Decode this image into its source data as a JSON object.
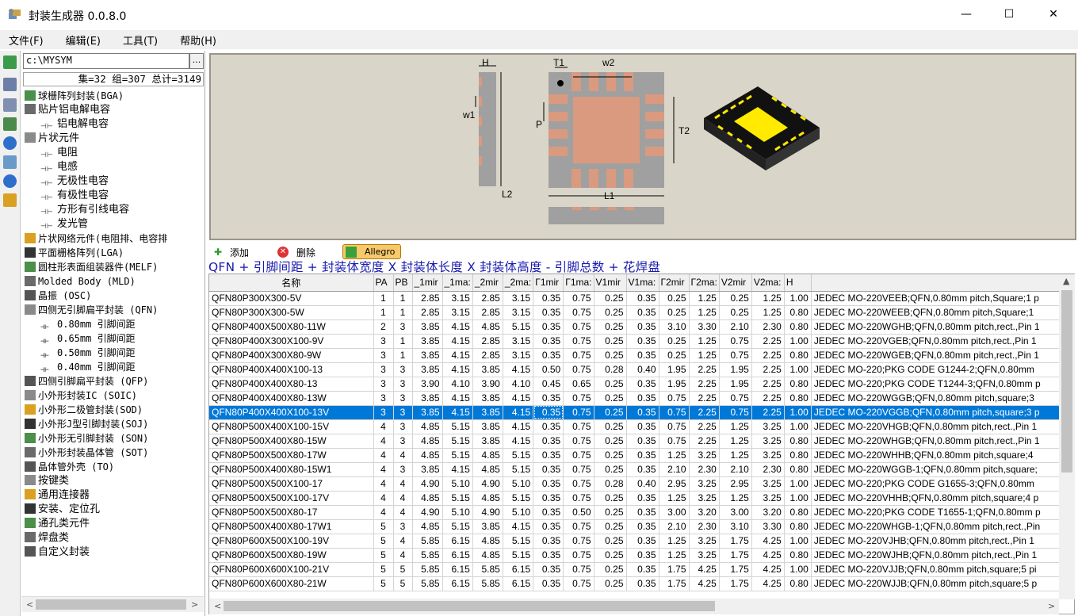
{
  "window": {
    "title": "封装生成器 0.0.8.0",
    "minimize": "—",
    "maximize": "☐",
    "close": "✕"
  },
  "menu": [
    {
      "label": "文件(F)"
    },
    {
      "label": "编辑(E)"
    },
    {
      "label": "工具(T)"
    },
    {
      "label": "帮助(H)"
    }
  ],
  "left_toolbar": [
    "import-icon",
    "library-icon",
    "list-icon",
    "tools-icon",
    "info-icon",
    "refresh-icon",
    "help-icon",
    "exit-icon"
  ],
  "path": {
    "value": "c:\\MYSYM",
    "browse": "..."
  },
  "stats": "集=32 组=307 总计=3149",
  "tree": [
    {
      "label": "球栅阵列封装(BGA)",
      "mono": true
    },
    {
      "label": "贴片铝电解电容"
    },
    {
      "label": "铝电解电容",
      "child": true
    },
    {
      "label": "片状元件"
    },
    {
      "label": "电阻",
      "child": true
    },
    {
      "label": "电感",
      "child": true
    },
    {
      "label": "无极性电容",
      "child": true
    },
    {
      "label": "有极性电容",
      "child": true
    },
    {
      "label": "方形有引线电容",
      "child": true
    },
    {
      "label": "发光管",
      "child": true
    },
    {
      "label": "片状网络元件(电阻排、电容排",
      "mono": true
    },
    {
      "label": "平面栅格阵列(LGA)",
      "mono": true
    },
    {
      "label": "圆柱形表面组装器件(MELF)",
      "mono": true
    },
    {
      "label": "Molded Body (MLD)",
      "mono": true
    },
    {
      "label": "晶振 (OSC)",
      "mono": true
    },
    {
      "label": "四侧无引脚扁平封装 (QFN)",
      "mono": true
    },
    {
      "label": "0.80mm 引脚间距",
      "child": true,
      "mono": true
    },
    {
      "label": "0.65mm 引脚间距",
      "child": true,
      "mono": true
    },
    {
      "label": "0.50mm 引脚间距",
      "child": true,
      "mono": true
    },
    {
      "label": "0.40mm 引脚间距",
      "child": true,
      "mono": true
    },
    {
      "label": "四侧引脚扁平封装 (QFP)",
      "mono": true
    },
    {
      "label": "小外形封装IC (SOIC)",
      "mono": true
    },
    {
      "label": "小外形二极管封装(SOD)",
      "mono": true
    },
    {
      "label": "小外形J型引脚封装(SOJ)",
      "mono": true
    },
    {
      "label": "小外形无引脚封装 (SON)",
      "mono": true
    },
    {
      "label": "小外形封装晶体管 (SOT)",
      "mono": true
    },
    {
      "label": "晶体管外壳 (TO)",
      "mono": true
    },
    {
      "label": "按键类"
    },
    {
      "label": "通用连接器"
    },
    {
      "label": "安装、定位孔"
    },
    {
      "label": "通孔类元件"
    },
    {
      "label": "焊盘类"
    },
    {
      "label": "自定义封装"
    }
  ],
  "preview_labels": {
    "H": "H",
    "w1": "w1",
    "L2": "L2",
    "T1": "T1",
    "w2": "w2",
    "P": "P",
    "T2": "T2",
    "L1": "L1"
  },
  "actions": {
    "add": "添加",
    "delete": "删除",
    "allegro": "Allegro"
  },
  "formula": "QFN + 引脚间距 + 封装体宽度 X 封装体长度 X 封装体高度 - 引脚总数 + 花焊盘",
  "columns": [
    "名称",
    "PA",
    "PB",
    "_1mir",
    "_1ma:",
    "_2mir",
    "_2ma:",
    "Γ1mir",
    "Γ1ma:",
    "V1mir",
    "V1ma:",
    "Γ2mir",
    "Γ2ma:",
    "V2mir",
    "V2ma:",
    "H",
    ""
  ],
  "rows": [
    [
      "QFN80P300X300-5V",
      "1",
      "1",
      "2.85",
      "3.15",
      "2.85",
      "3.15",
      "0.35",
      "0.75",
      "0.25",
      "0.35",
      "0.25",
      "1.25",
      "0.25",
      "1.25",
      "1.00",
      "JEDEC MO-220VEEB;QFN,0.80mm pitch,Square;1 p"
    ],
    [
      "QFN80P300X300-5W",
      "1",
      "1",
      "2.85",
      "3.15",
      "2.85",
      "3.15",
      "0.35",
      "0.75",
      "0.25",
      "0.35",
      "0.25",
      "1.25",
      "0.25",
      "1.25",
      "0.80",
      "JEDEC MO-220WEEB;QFN,0.80mm pitch,Square;1"
    ],
    [
      "QFN80P400X500X80-11W",
      "2",
      "3",
      "3.85",
      "4.15",
      "4.85",
      "5.15",
      "0.35",
      "0.75",
      "0.25",
      "0.35",
      "3.10",
      "3.30",
      "2.10",
      "2.30",
      "0.80",
      "JEDEC MO-220WGHB;QFN,0.80mm pitch,rect.,Pin 1"
    ],
    [
      "QFN80P400X300X100-9V",
      "3",
      "1",
      "3.85",
      "4.15",
      "2.85",
      "3.15",
      "0.35",
      "0.75",
      "0.25",
      "0.35",
      "0.25",
      "1.25",
      "0.75",
      "2.25",
      "1.00",
      "JEDEC MO-220VGEB;QFN,0.80mm pitch,rect.,Pin 1"
    ],
    [
      "QFN80P400X300X80-9W",
      "3",
      "1",
      "3.85",
      "4.15",
      "2.85",
      "3.15",
      "0.35",
      "0.75",
      "0.25",
      "0.35",
      "0.25",
      "1.25",
      "0.75",
      "2.25",
      "0.80",
      "JEDEC MO-220WGEB;QFN,0.80mm pitch,rect.,Pin 1"
    ],
    [
      "QFN80P400X400X100-13",
      "3",
      "3",
      "3.85",
      "4.15",
      "3.85",
      "4.15",
      "0.50",
      "0.75",
      "0.28",
      "0.40",
      "1.95",
      "2.25",
      "1.95",
      "2.25",
      "1.00",
      "JEDEC MO-220;PKG CODE G1244-2;QFN,0.80mm"
    ],
    [
      "QFN80P400X400X80-13",
      "3",
      "3",
      "3.90",
      "4.10",
      "3.90",
      "4.10",
      "0.45",
      "0.65",
      "0.25",
      "0.35",
      "1.95",
      "2.25",
      "1.95",
      "2.25",
      "0.80",
      "JEDEC MO-220;PKG CODE T1244-3;QFN,0.80mm p"
    ],
    [
      "QFN80P400X400X80-13W",
      "3",
      "3",
      "3.85",
      "4.15",
      "3.85",
      "4.15",
      "0.35",
      "0.75",
      "0.25",
      "0.35",
      "0.75",
      "2.25",
      "0.75",
      "2.25",
      "0.80",
      "JEDEC MO-220WGGB;QFN,0.80mm pitch,square;3"
    ],
    [
      "QFN80P400X400X100-13V",
      "3",
      "3",
      "3.85",
      "4.15",
      "3.85",
      "4.15",
      "0.35",
      "0.75",
      "0.25",
      "0.35",
      "0.75",
      "2.25",
      "0.75",
      "2.25",
      "1.00",
      "JEDEC MO-220VGGB;QFN,0.80mm pitch,square;3 p"
    ],
    [
      "QFN80P500X400X100-15V",
      "4",
      "3",
      "4.85",
      "5.15",
      "3.85",
      "4.15",
      "0.35",
      "0.75",
      "0.25",
      "0.35",
      "0.75",
      "2.25",
      "1.25",
      "3.25",
      "1.00",
      "JEDEC MO-220VHGB;QFN,0.80mm pitch,rect.,Pin 1"
    ],
    [
      "QFN80P500X400X80-15W",
      "4",
      "3",
      "4.85",
      "5.15",
      "3.85",
      "4.15",
      "0.35",
      "0.75",
      "0.25",
      "0.35",
      "0.75",
      "2.25",
      "1.25",
      "3.25",
      "0.80",
      "JEDEC MO-220WHGB;QFN,0.80mm pitch,rect.,Pin 1"
    ],
    [
      "QFN80P500X500X80-17W",
      "4",
      "4",
      "4.85",
      "5.15",
      "4.85",
      "5.15",
      "0.35",
      "0.75",
      "0.25",
      "0.35",
      "1.25",
      "3.25",
      "1.25",
      "3.25",
      "0.80",
      "JEDEC MO-220WHHB;QFN,0.80mm pitch,square;4"
    ],
    [
      "QFN80P500X400X80-15W1",
      "4",
      "3",
      "3.85",
      "4.15",
      "4.85",
      "5.15",
      "0.35",
      "0.75",
      "0.25",
      "0.35",
      "2.10",
      "2.30",
      "2.10",
      "2.30",
      "0.80",
      "JEDEC MO-220WGGB-1;QFN,0.80mm pitch,square;"
    ],
    [
      "QFN80P500X500X100-17",
      "4",
      "4",
      "4.90",
      "5.10",
      "4.90",
      "5.10",
      "0.35",
      "0.75",
      "0.28",
      "0.40",
      "2.95",
      "3.25",
      "2.95",
      "3.25",
      "1.00",
      "JEDEC MO-220;PKG CODE G1655-3;QFN,0.80mm"
    ],
    [
      "QFN80P500X500X100-17V",
      "4",
      "4",
      "4.85",
      "5.15",
      "4.85",
      "5.15",
      "0.35",
      "0.75",
      "0.25",
      "0.35",
      "1.25",
      "3.25",
      "1.25",
      "3.25",
      "1.00",
      "JEDEC MO-220VHHB;QFN,0.80mm pitch,square;4 p"
    ],
    [
      "QFN80P500X500X80-17",
      "4",
      "4",
      "4.90",
      "5.10",
      "4.90",
      "5.10",
      "0.35",
      "0.50",
      "0.25",
      "0.35",
      "3.00",
      "3.20",
      "3.00",
      "3.20",
      "0.80",
      "JEDEC MO-220;PKG CODE T1655-1;QFN,0.80mm p"
    ],
    [
      "QFN80P500X400X80-17W1",
      "5",
      "3",
      "4.85",
      "5.15",
      "3.85",
      "4.15",
      "0.35",
      "0.75",
      "0.25",
      "0.35",
      "2.10",
      "2.30",
      "3.10",
      "3.30",
      "0.80",
      "JEDEC MO-220WHGB-1;QFN,0.80mm pitch,rect.,Pin"
    ],
    [
      "QFN80P600X500X100-19V",
      "5",
      "4",
      "5.85",
      "6.15",
      "4.85",
      "5.15",
      "0.35",
      "0.75",
      "0.25",
      "0.35",
      "1.25",
      "3.25",
      "1.75",
      "4.25",
      "1.00",
      "JEDEC MO-220VJHB;QFN,0.80mm pitch,rect.,Pin 1"
    ],
    [
      "QFN80P600X500X80-19W",
      "5",
      "4",
      "5.85",
      "6.15",
      "4.85",
      "5.15",
      "0.35",
      "0.75",
      "0.25",
      "0.35",
      "1.25",
      "3.25",
      "1.75",
      "4.25",
      "0.80",
      "JEDEC MO-220WJHB;QFN,0.80mm pitch,rect.,Pin 1"
    ],
    [
      "QFN80P600X600X100-21V",
      "5",
      "5",
      "5.85",
      "6.15",
      "5.85",
      "6.15",
      "0.35",
      "0.75",
      "0.25",
      "0.35",
      "1.75",
      "4.25",
      "1.75",
      "4.25",
      "1.00",
      "JEDEC MO-220VJJB;QFN,0.80mm pitch,square;5 pi"
    ],
    [
      "QFN80P600X600X80-21W",
      "5",
      "5",
      "5.85",
      "6.15",
      "5.85",
      "6.15",
      "0.35",
      "0.75",
      "0.25",
      "0.35",
      "1.75",
      "4.25",
      "1.75",
      "4.25",
      "0.80",
      "JEDEC MO-220WJJB;QFN,0.80mm pitch,square;5 p"
    ]
  ],
  "selected_row": 8,
  "colors": {
    "accent": "#0078d7",
    "pad": "#d99a80",
    "body": "#a0a0a0",
    "chip_yellow": "#ffea00",
    "formula": "#1a1ab0"
  }
}
